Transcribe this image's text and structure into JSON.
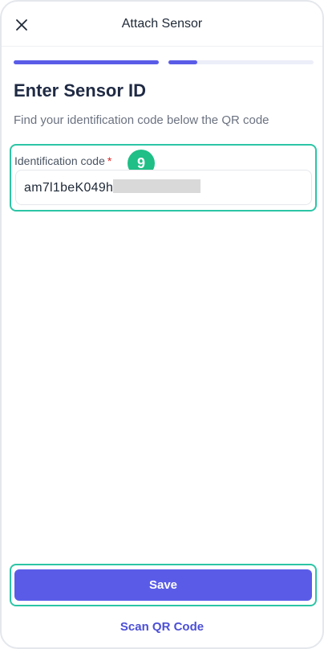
{
  "header": {
    "title": "Attach Sensor",
    "close_icon": "close-icon"
  },
  "progress": {
    "steps_total": 2,
    "current_step": 2,
    "current_step_fraction": 0.2,
    "accent_color": "#5a5ce8",
    "track_color": "#eceef8"
  },
  "main": {
    "title": "Enter Sensor ID",
    "subtitle": "Find your identification code below the QR code"
  },
  "identification_field": {
    "label": "Identification code",
    "required_marker": "*",
    "value": "am7l1beK049h",
    "step_badge": "9"
  },
  "actions": {
    "save_label": "Save",
    "scan_label": "Scan QR Code"
  },
  "colors": {
    "highlight": "#2cc5a6",
    "badge": "#1fbf87",
    "primary": "#5a5ce8",
    "link": "#4c4fd6"
  }
}
